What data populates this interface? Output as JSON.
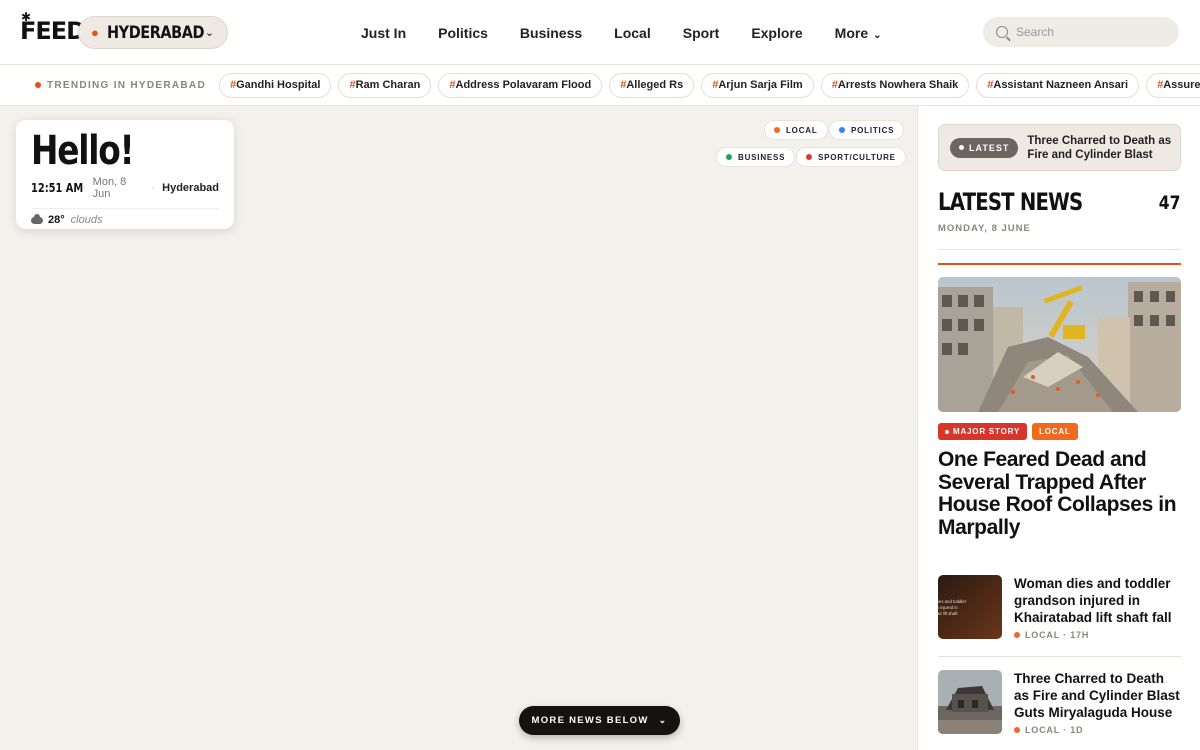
{
  "header": {
    "logo": "FEED",
    "location": "HYDERABAD",
    "nav": [
      "Just In",
      "Politics",
      "Business",
      "Local",
      "Sport",
      "Explore",
      "More"
    ],
    "search_placeholder": "Search"
  },
  "trending": {
    "label": "TRENDING IN HYDERABAD",
    "tags": [
      "Gandhi Hospital",
      "Ram Charan",
      "Address Polavaram Flood",
      "Alleged Rs",
      "Arjun Sarja Film",
      "Arrests Nowhera Shaik",
      "Assistant Nazneen Ansari",
      "Assures Re"
    ]
  },
  "greeting": {
    "title": "Hello!",
    "time": "12:51 AM",
    "date": "Mon, 8 Jun",
    "city": "Hyderabad",
    "temp": "28°",
    "condition": "clouds"
  },
  "legend": [
    {
      "label": "LOCAL",
      "color": "#ef6a1f"
    },
    {
      "label": "POLITICS",
      "color": "#3b82f6"
    },
    {
      "label": "BUSINESS",
      "color": "#22a35a"
    },
    {
      "label": "SPORT/CULTURE",
      "color": "#e0363a"
    }
  ],
  "more_button": "MORE NEWS BELOW",
  "sidebar": {
    "latest_badge": "LATEST",
    "latest_headline": "Three Charred to Death as Fire and Cylinder Blast Guts Miryalaguda House",
    "title": "LATEST NEWS",
    "count": "47",
    "date": "MONDAY, 8 JUNE",
    "lead": {
      "badge_major": "MAJOR STORY",
      "badge_category": "LOCAL",
      "headline": "One Feared Dead and Several Trapped After House Roof Collapses in Marpally"
    },
    "stories": [
      {
        "title": "Woman dies and toddler grandson injured in Khairatabad lift shaft fall",
        "meta": "LOCAL · 17H",
        "thumb_text": "n dies and toddler son injured in abad lift shaft"
      },
      {
        "title": "Three Charred to Death as Fire and Cylinder Blast Guts Miryalaguda House",
        "meta": "LOCAL · 1D"
      }
    ]
  },
  "colors": {
    "accent": "#e0531a",
    "local": "#ef6a1f",
    "major": "#d8352b"
  }
}
